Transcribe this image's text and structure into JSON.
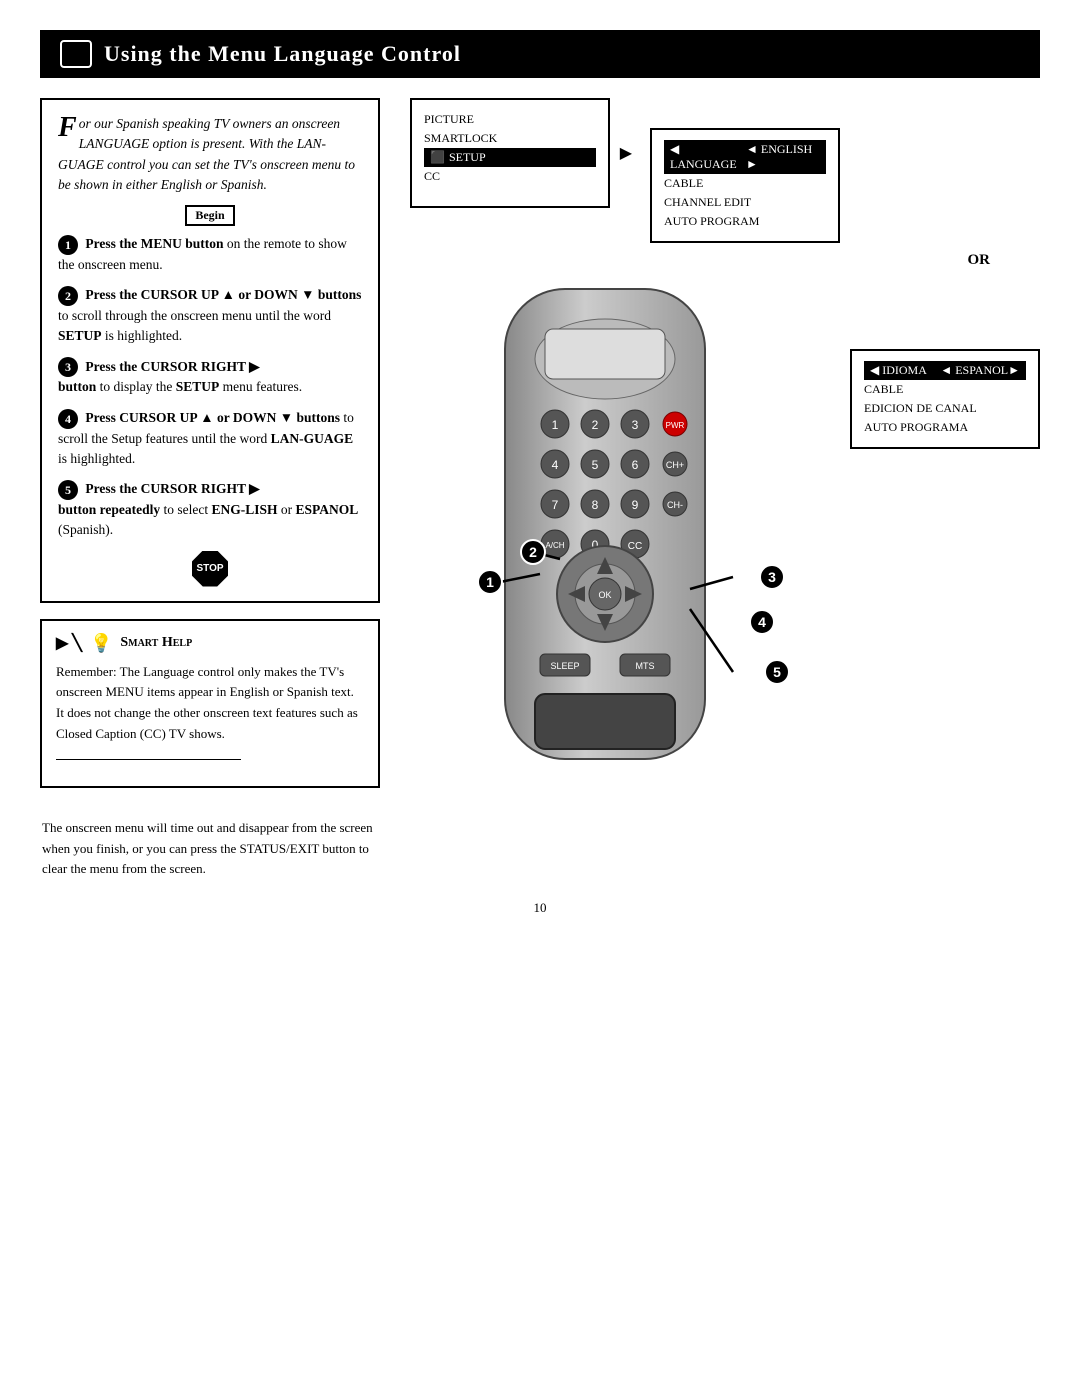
{
  "header": {
    "title": "Using the Menu Language Control",
    "icon": "tv-icon"
  },
  "intro": {
    "drop_cap": "F",
    "text": "or our Spanish speaking TV owners an onscreen LANGUAGE option is present. With the LANGUAGE control you can set the TV's onscreen menu to be shown in either English or Spanish."
  },
  "begin_label": "Begin",
  "steps": [
    {
      "num": "1",
      "text": "Press the MENU button on the remote to show the onscreen menu."
    },
    {
      "num": "2",
      "text": "Press the CURSOR UP ▲ or DOWN ▼ buttons to scroll through the onscreen menu until the word SETUP is highlighted."
    },
    {
      "num": "3",
      "text": "Press the CURSOR RIGHT ▶ button to display the SETUP menu features."
    },
    {
      "num": "4",
      "text": "Press CURSOR UP ▲ or DOWN ▼ buttons to scroll the Setup features until the word LANGUAGE is highlighted."
    },
    {
      "num": "5",
      "text": "Press the CURSOR RIGHT ▶ button repeatedly to select ENGLISH or ESPANOL (Spanish)."
    }
  ],
  "stop_label": "STOP",
  "smart_help": {
    "title": "Smart Help",
    "body": "Remember: The Language control only makes the TV's onscreen MENU items appear in English or Spanish text. It does not change the other onscreen text features such as Closed Caption (CC) TV shows."
  },
  "bottom_note": "The onscreen menu will time out and disappear from the screen when you finish, or you can press the STATUS/EXIT button to clear the menu from the screen.",
  "screen1": {
    "items": [
      "PICTURE",
      "SMARTLOCK",
      "SETUP",
      "CC"
    ],
    "highlighted": "SETUP",
    "arrow": "▶"
  },
  "setup_menu": {
    "items": [
      "LANGUAGE",
      "CABLE",
      "CHANNEL EDIT",
      "AUTO PROGRAM"
    ],
    "highlighted_item": "LANGUAGE",
    "highlighted_value": "◄ ENGLISH ►"
  },
  "or_label": "OR",
  "setup_menu_spanish": {
    "items": [
      "IDIOMA",
      "CABLE",
      "EDICION DE CANAL",
      "AUTO PROGRAMA"
    ],
    "highlighted_item": "IDIOMA",
    "highlighted_value": "◄ ESPANOL ►"
  },
  "remote_buttons": {
    "row1": [
      "1",
      "2",
      "3",
      "POWER"
    ],
    "row2": [
      "4",
      "5",
      "6",
      "CH+"
    ],
    "row3": [
      "7",
      "8",
      "9",
      "CH-"
    ],
    "row4": [
      "A/CH",
      "0",
      "CC",
      ""
    ],
    "sleep": "SLEEP",
    "mts": "MTS"
  },
  "step_badges": [
    {
      "num": "1",
      "position": "nav_menu"
    },
    {
      "num": "2",
      "position": "cursor_up"
    },
    {
      "num": "3",
      "position": "cursor_right"
    },
    {
      "num": "4",
      "position": "cursor_up2"
    },
    {
      "num": "5",
      "position": "cursor_right2"
    }
  ],
  "page_number": "10"
}
